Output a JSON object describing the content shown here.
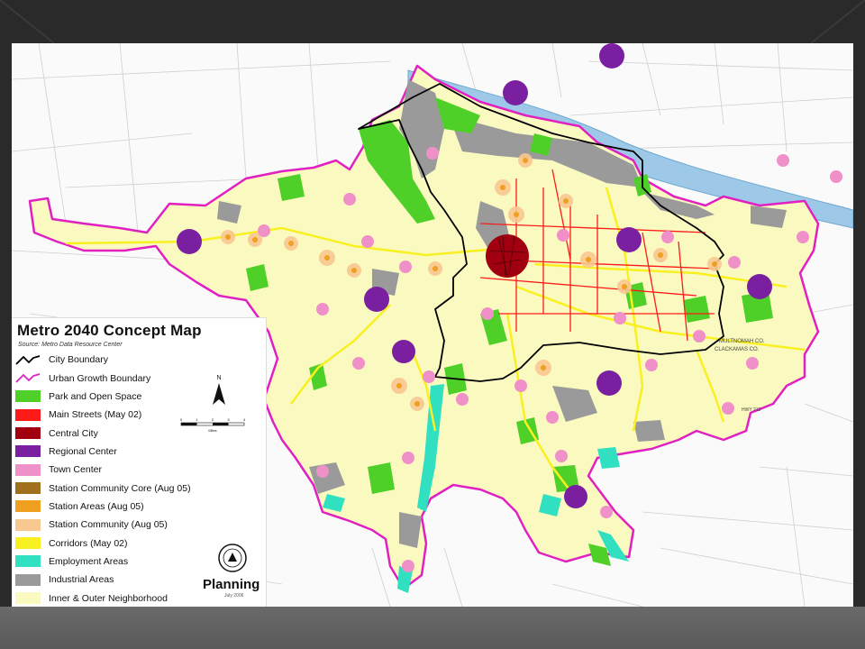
{
  "map": {
    "title": "Metro 2040 Concept Map",
    "source": "Source: Metro Data Resource Center",
    "north_label": "N",
    "scale_label": "Miles",
    "scale_ticks": [
      "0",
      "1",
      "2",
      "3",
      "4"
    ],
    "credit": "Planning",
    "date": "July 2006",
    "county_labels": [
      "MULTNOMAH CO.",
      "CLACKAMAS CO."
    ],
    "highway_labels": [
      "HWY 212"
    ]
  },
  "legend": {
    "items": [
      {
        "label": "City Boundary",
        "swatch": "line",
        "color": "#000000"
      },
      {
        "label": "Urban Growth Boundary",
        "swatch": "line",
        "color": "#e020c0"
      },
      {
        "label": "Park and Open Space",
        "swatch": "box",
        "color": "#4fd028"
      },
      {
        "label": "Main Streets (May 02)",
        "swatch": "box",
        "color": "#ff1a1a"
      },
      {
        "label": "Central City",
        "swatch": "box",
        "color": "#a00010"
      },
      {
        "label": "Regional Center",
        "swatch": "box",
        "color": "#7a1fa0"
      },
      {
        "label": "Town Center",
        "swatch": "box",
        "color": "#f090c8"
      },
      {
        "label": "Station Community Core (Aug 05)",
        "swatch": "box",
        "color": "#a0701e"
      },
      {
        "label": "Station Areas (Aug 05)",
        "swatch": "box",
        "color": "#f0a020"
      },
      {
        "label": "Station Community (Aug 05)",
        "swatch": "box",
        "color": "#f8c890"
      },
      {
        "label": "Corridors (May 02)",
        "swatch": "box",
        "color": "#f8f020"
      },
      {
        "label": "Employment Areas",
        "swatch": "box",
        "color": "#30e0c0"
      },
      {
        "label": "Industrial Areas",
        "swatch": "box",
        "color": "#9a9a9a"
      },
      {
        "label": "Inner & Outer Neighborhood",
        "swatch": "box",
        "color": "#fafac0"
      }
    ]
  },
  "colors": {
    "slide_background": "#2b2b2b",
    "ugb": "#e020c0",
    "neighborhood": "#fafac0",
    "river": "#9dc8e8",
    "park": "#4fd028",
    "regional_center": "#7a1fa0",
    "town_center": "#f090c8",
    "central_city": "#a00010",
    "main_street": "#ff1a1a",
    "corridor": "#f8f020",
    "employment": "#30e0c0",
    "industrial": "#9a9a9a"
  }
}
